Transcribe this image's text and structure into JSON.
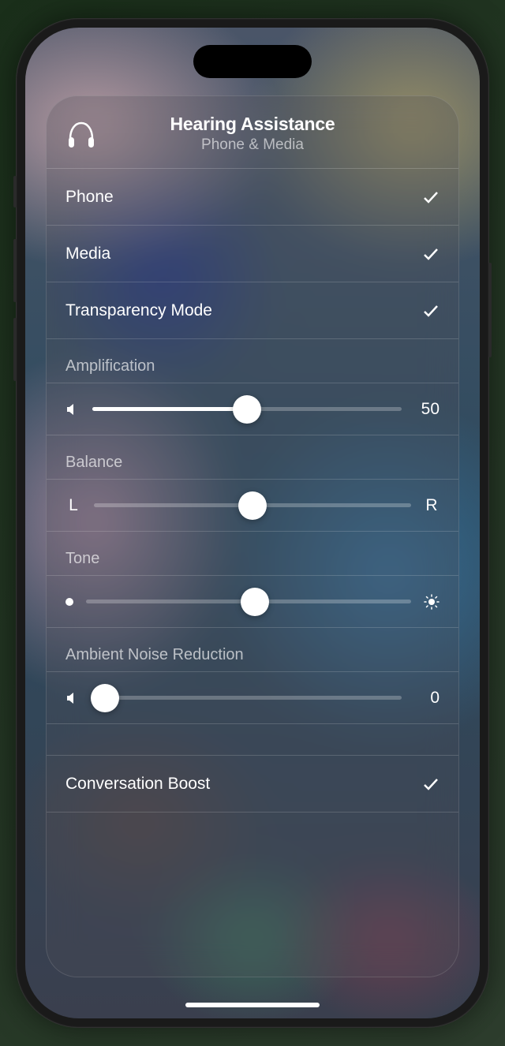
{
  "header": {
    "title": "Hearing Assistance",
    "subtitle": "Phone & Media"
  },
  "rows": {
    "phone": {
      "label": "Phone",
      "checked": true
    },
    "media": {
      "label": "Media",
      "checked": true
    },
    "transparency": {
      "label": "Transparency Mode",
      "checked": true
    },
    "conversationBoost": {
      "label": "Conversation Boost",
      "checked": true
    }
  },
  "sliders": {
    "amplification": {
      "label": "Amplification",
      "value": 50,
      "percent": 50
    },
    "balance": {
      "label": "Balance",
      "left": "L",
      "right": "R",
      "percent": 50
    },
    "tone": {
      "label": "Tone",
      "percent": 52
    },
    "ambientNoise": {
      "label": "Ambient Noise Reduction",
      "value": 0,
      "percent": 4
    }
  }
}
